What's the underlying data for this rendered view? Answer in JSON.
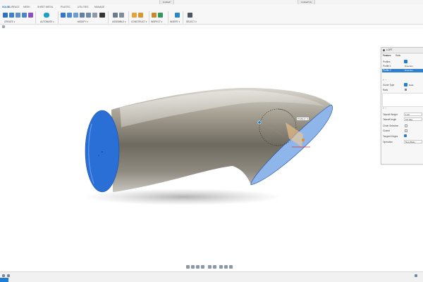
{
  "window": {
    "doc_tab_1": "Untitled*",
    "doc_tab_2": "Untitled*(1)"
  },
  "ribbon": {
    "tabs": [
      "SOLID",
      "SURFACE",
      "MESH",
      "SHEET METAL",
      "PLASTIC",
      "UTILITIES",
      "MANAGE"
    ],
    "active_tab": "SOLID",
    "groups": [
      "CREATE ▾",
      "AUTOMATE ▾",
      "MODIFY ▾",
      "ASSEMBLE ▾",
      "CONSTRUCT ▾",
      "INSPECT ▾",
      "INSERT ▾",
      "SELECT ▾"
    ]
  },
  "colors": {
    "accent": "#1e7fd4",
    "face_blue": "#2a6fd6",
    "profile_orange": "#f08a1a",
    "panel_bg": "#f7f7f7"
  },
  "loft_panel": {
    "title": "LOFT",
    "tabs": [
      "Feature",
      "Rails"
    ],
    "profiles_label": "Profiles",
    "profile_rows": [
      "Profile 1",
      "Profile 2"
    ],
    "profile_values": [
      "Direction",
      "Direction"
    ],
    "rails_label": "Rails",
    "guide_type_label": "Guide Type",
    "guide_type_value": "Rails",
    "takeoff_weight_label": "Takeoff Weight",
    "takeoff_weight_value": "1.00",
    "takeoff_angle_label": "Takeoff Angle",
    "takeoff_angle_value": "0.0 deg",
    "chain_selection_label": "Chain Selection",
    "closed_label": "Closed",
    "tangent_edges_label": "Tangent Edges",
    "operation_label": "Operation",
    "operation_value": "New Body"
  },
  "canvas": {
    "manipulator_label": "Profile 2 : 0"
  },
  "navbar": {
    "icons": [
      "orbit-icon",
      "pan-icon",
      "zoom-icon",
      "fit-icon",
      "display-icon",
      "grid-icon",
      "viewport-icon"
    ]
  }
}
